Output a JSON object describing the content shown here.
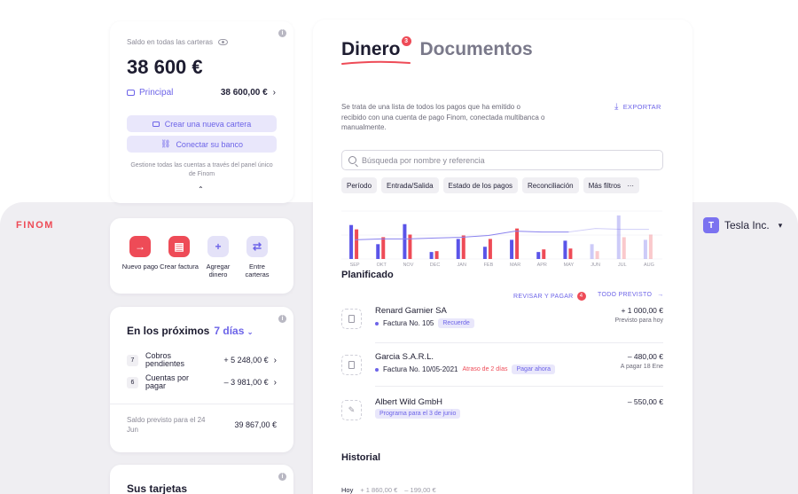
{
  "app": {
    "logo": "FINOM",
    "company": "Tesla Inc.",
    "company_initial": "T"
  },
  "balance": {
    "label": "Saldo en todas las carteras",
    "amount": "38 600 €",
    "wallet_name": "Principal",
    "wallet_amount": "38 600,00 €",
    "create_wallet": "Crear una nueva cartera",
    "connect_bank": "Conectar su banco",
    "manage_text": "Gestione todas las cuentas a través del panel único de Finom"
  },
  "actions": [
    {
      "label": "Nuevo pago",
      "icon": "arrow-right-icon",
      "glyph": "→",
      "style": "red"
    },
    {
      "label": "Crear factura",
      "icon": "invoice-icon",
      "glyph": "▤",
      "style": "red"
    },
    {
      "label": "Agregar dinero",
      "icon": "plus-icon",
      "glyph": "+",
      "style": "lilac"
    },
    {
      "label": "Entre carteras",
      "icon": "transfer-icon",
      "glyph": "⇄",
      "style": "lilac"
    }
  ],
  "upcoming": {
    "title": "En los próximos",
    "period": "7 días",
    "rows": [
      {
        "count": "7",
        "label": "Cobros pendientes",
        "amount": "+ 5 248,00 €"
      },
      {
        "count": "6",
        "label": "Cuentas por pagar",
        "amount": "– 3 981,00 €"
      }
    ],
    "forecast_label": "Saldo previsto para el 24 Jun",
    "forecast_amount": "39 867,00 €"
  },
  "cards": {
    "title": "Sus tarjetas"
  },
  "main": {
    "tab_money": "Dinero",
    "tab_money_badge": "3",
    "tab_documents": "Documentos",
    "description": "Se trata de una lista de todos los pagos que ha emitido o recibido con una cuenta de pago Finom, conectada multibanca o manualmente.",
    "export": "EXPORTAR",
    "search_placeholder": "Búsqueda por nombre y referencia",
    "filters": [
      "Período",
      "Entrada/Salida",
      "Estado de los pagos",
      "Reconciliación",
      "Más filtros"
    ],
    "filters_more": "···"
  },
  "chart_data": {
    "type": "bar",
    "categories": [
      "SEP",
      "OKT",
      "NOV",
      "DEC",
      "JAN",
      "FEB",
      "MAR",
      "APR",
      "MAY",
      "JUN",
      "JUL",
      "AUG"
    ],
    "series": [
      {
        "kind": "incoming",
        "color": "#5a54e8",
        "values": [
          39,
          17,
          40,
          8,
          23,
          14,
          22,
          8,
          21,
          17,
          50,
          22
        ]
      },
      {
        "kind": "outgoing",
        "color": "#ee4b57",
        "values": [
          34,
          25,
          28,
          9,
          27,
          23,
          35,
          11,
          12,
          9,
          25,
          28
        ]
      },
      {
        "kind": "balance",
        "color": "#8a82ee",
        "values": [
          22,
          23,
          23,
          24,
          25,
          27,
          32,
          31,
          31,
          35,
          34,
          34
        ]
      }
    ],
    "forecast_from": "JUN",
    "ylim": [
      0,
      55
    ]
  },
  "planned": {
    "title": "Planificado",
    "review_label": "REVISAR Y PAGAR",
    "review_count": "4",
    "all_label": "TODO PREVISTO",
    "items": [
      {
        "name": "Renard Garnier SA",
        "ref": "Factura No. 105",
        "late": "",
        "tag": "Recuerde",
        "amount": "+ 1 000,00 €",
        "sub": "Previsto para hoy"
      },
      {
        "name": "Garcia S.A.R.L.",
        "ref": "Factura No. 10/05-2021",
        "late": "Atraso de 2 días",
        "tag": "Pagar ahora",
        "amount": "– 480,00 €",
        "sub": "A pagar 18 Ene"
      },
      {
        "name": "Albert Wild GmbH",
        "ref": "",
        "late": "",
        "tag": "Programa para el 3 de junio",
        "amount": "– 550,00 €",
        "sub": ""
      }
    ]
  },
  "history": {
    "title": "Historial",
    "day": "Hoy",
    "income": "+ 1 860,00 €",
    "outgo": "– 199,00 €"
  }
}
